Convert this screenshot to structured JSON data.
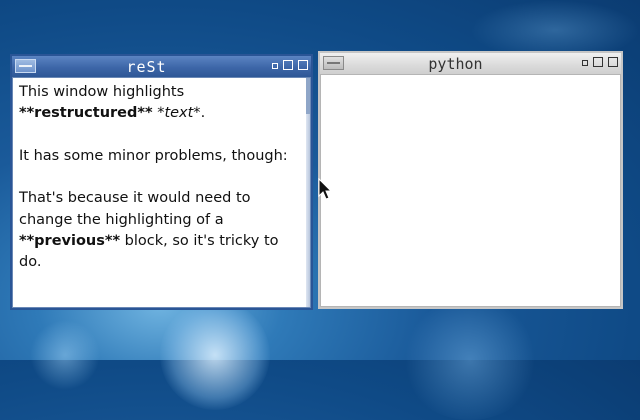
{
  "windows": {
    "rest": {
      "title": "reSt",
      "content": {
        "l1": "This window highlights",
        "l2_bold": "**restructured**",
        "l2_space": " ",
        "l2_italic": "*text*",
        "l2_end": ".",
        "l3": "It has some minor problems, though:",
        "l4": "That's because it would need to",
        "l5": "change the highlighting of a",
        "l6_bold": "**previous**",
        "l6_rest": " block, so it's tricky to",
        "l7": "do."
      }
    },
    "python": {
      "title": "python",
      "content": ""
    }
  },
  "icons": {
    "window_menu": "window-menu-icon",
    "minimize": "minimize-icon",
    "maximize": "maximize-icon",
    "close": "close-icon",
    "cursor": "mouse-pointer-icon"
  },
  "colors": {
    "active_border": "#2a5596",
    "inactive_border": "#c6c6c6",
    "desktop": "#1a5a9a"
  }
}
